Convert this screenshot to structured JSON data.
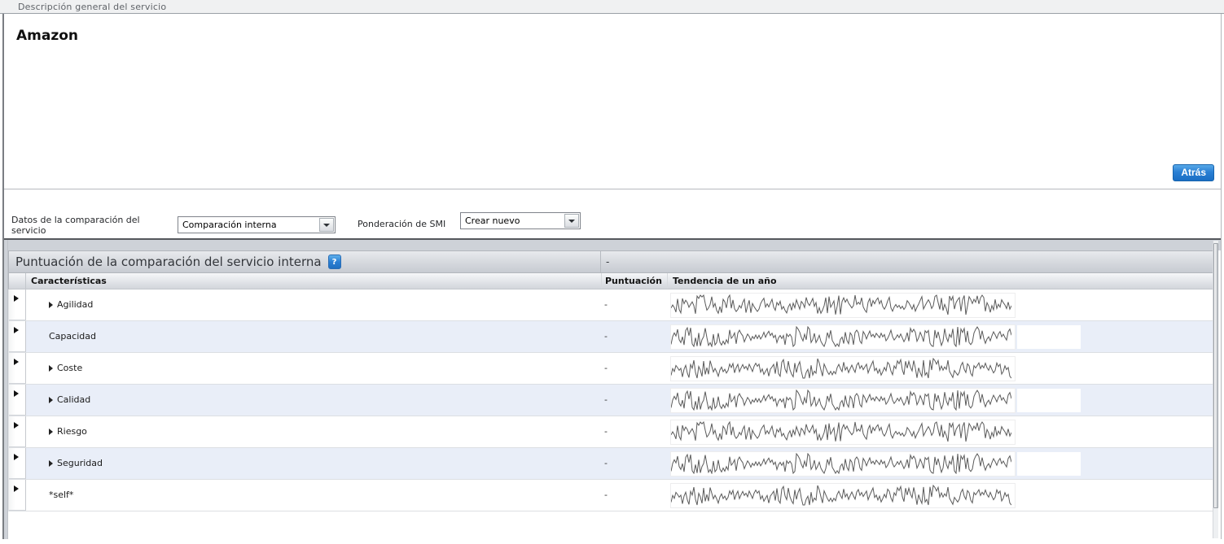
{
  "titlebar": {
    "title": "Descripción general del servicio"
  },
  "overview": {
    "service_name": "Amazon",
    "back_label": "Atrás"
  },
  "controls": {
    "comparison": {
      "label": "Datos de la comparación del servicio",
      "value": "Comparación interna"
    },
    "smi": {
      "label": "Ponderación de SMI",
      "value": "Crear nuevo"
    }
  },
  "scores_panel": {
    "title": "Puntuación de la comparación del servicio interna",
    "help_label": "?",
    "overall_score": "-",
    "columns": {
      "characteristics": "Características",
      "score": "Puntuación",
      "trend": "Tendencia de un año"
    },
    "rows": [
      {
        "name": "Agilidad",
        "expandable": true,
        "score": "-",
        "shaded": false,
        "trend_seed": 101,
        "has_empty_box": false
      },
      {
        "name": "Capacidad",
        "expandable": false,
        "score": "-",
        "shaded": true,
        "trend_seed": 202,
        "has_empty_box": true
      },
      {
        "name": "Coste",
        "expandable": true,
        "score": "-",
        "shaded": false,
        "trend_seed": 303,
        "has_empty_box": false
      },
      {
        "name": "Calidad",
        "expandable": true,
        "score": "-",
        "shaded": true,
        "trend_seed": 202,
        "has_empty_box": true
      },
      {
        "name": "Riesgo",
        "expandable": true,
        "score": "-",
        "shaded": false,
        "trend_seed": 101,
        "has_empty_box": false
      },
      {
        "name": "Seguridad",
        "expandable": true,
        "score": "-",
        "shaded": true,
        "trend_seed": 202,
        "has_empty_box": true
      },
      {
        "name": "*self*",
        "expandable": false,
        "score": "-",
        "shaded": false,
        "trend_seed": 303,
        "has_empty_box": false
      }
    ]
  },
  "colors": {
    "accent_blue": "#2a7fd4",
    "shaded_row": "#e9eef8",
    "spark_stroke": "#5a5a5a"
  }
}
